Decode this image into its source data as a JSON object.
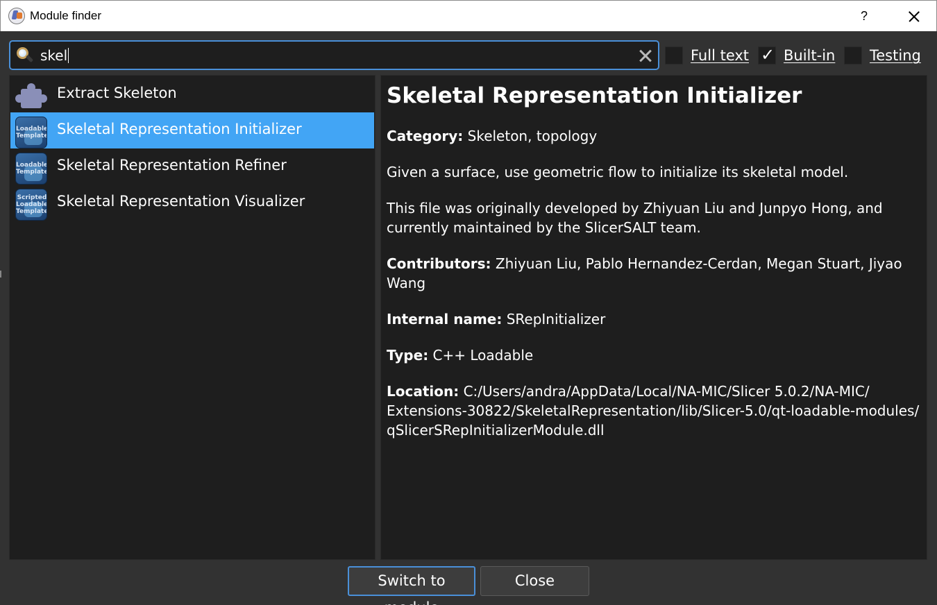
{
  "window": {
    "title": "Module finder",
    "help_label": "?"
  },
  "search": {
    "value": "skel"
  },
  "filters": {
    "full_text": {
      "label": "Full text",
      "checked": false
    },
    "built_in": {
      "label": "Built-in",
      "checked": true
    },
    "testing": {
      "label": "Testing",
      "checked": false
    }
  },
  "modules": [
    {
      "label": "Extract Skeleton",
      "icon": "puzzle-icon",
      "selected": false
    },
    {
      "label": "Skeletal Representation Initializer",
      "icon": "loadable-template-icon",
      "icon_text": [
        "Loadable",
        "Template"
      ],
      "selected": true
    },
    {
      "label": "Skeletal Representation Refiner",
      "icon": "loadable-template-icon",
      "icon_text": [
        "Loadable",
        "Template"
      ],
      "selected": false
    },
    {
      "label": "Skeletal Representation Visualizer",
      "icon": "scripted-loadable-template-icon",
      "icon_text": [
        "Scripted",
        "Loadable",
        "Template"
      ],
      "selected": false
    }
  ],
  "details": {
    "title": "Skeletal Representation Initializer",
    "category_label": "Category:",
    "category_value": "Skeleton, topology",
    "description": "Given a surface, use geometric flow to initialize its skeletal model.",
    "acknowledgement_line1": "This file was originally developed by Zhiyuan Liu and Junpyo Hong, and",
    "acknowledgement_line2": "currently maintained by the SlicerSALT team.",
    "contributors_label": "Contributors:",
    "contributors_value_line1": "Zhiyuan Liu, Pablo Hernandez-Cerdan, Megan Stuart, Jiyao",
    "contributors_value_line2": "Wang",
    "internal_name_label": "Internal name:",
    "internal_name_value": "SRepInitializer",
    "type_label": "Type:",
    "type_value": "C++ Loadable",
    "location_label": "Location:",
    "location_value_line1": "C:/Users/andra/AppData/Local/NA-MIC/Slicer 5.0.2/NA-MIC/",
    "location_value_line2": "Extensions-30822/SkeletalRepresentation/lib/Slicer-5.0/qt-loadable-modules/",
    "location_value_line3": "qSlicerSRepInitializerModule.dll"
  },
  "buttons": {
    "switch_label": "Switch to module",
    "close_label": "Close"
  },
  "colors": {
    "accent": "#42a5f5",
    "focus_border": "#4a90d9",
    "background": "#323232",
    "panel": "#1e1e1e"
  }
}
